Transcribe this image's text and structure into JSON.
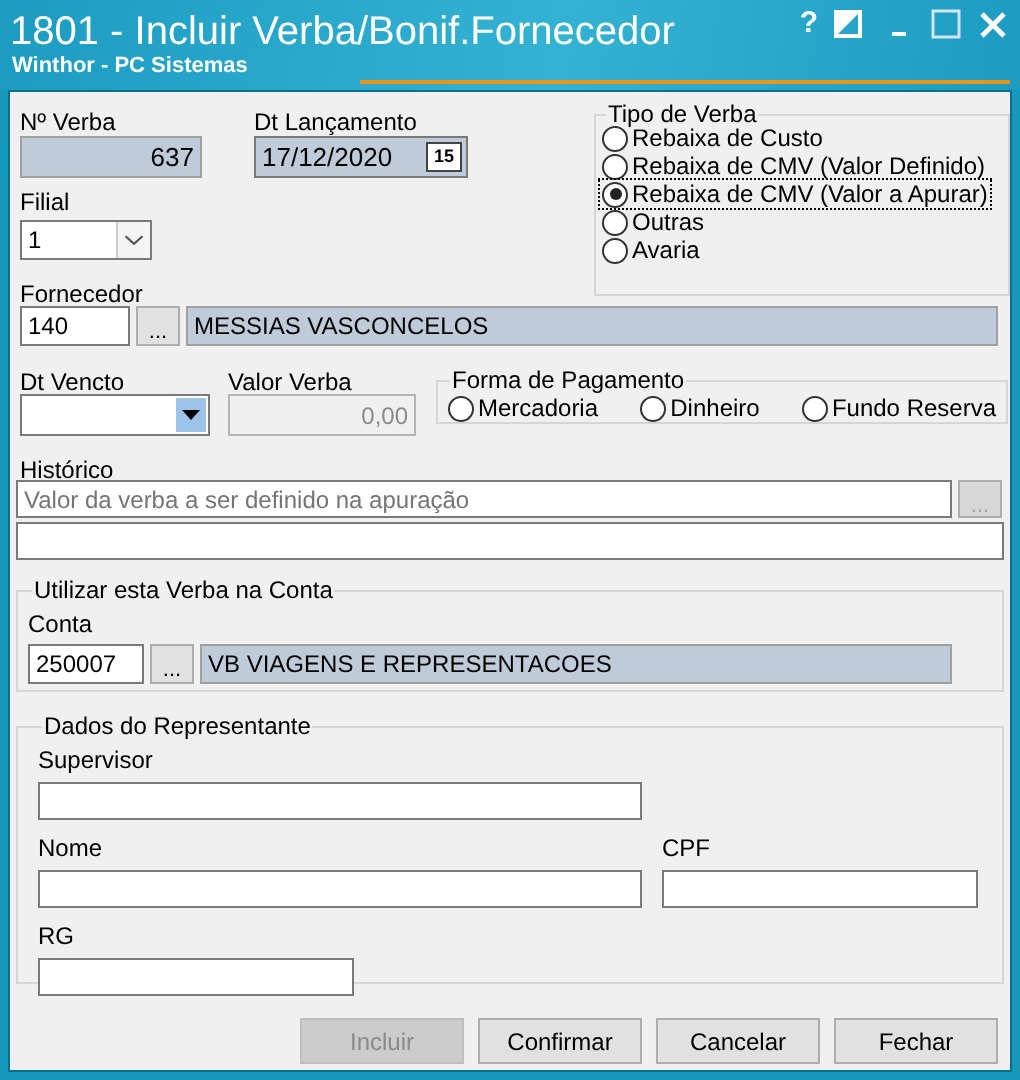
{
  "window": {
    "title": "1801 - Incluir Verba/Bonif.Fornecedor",
    "subtitle": "Winthor - PC Sistemas",
    "help_glyph": "?"
  },
  "verba_number": {
    "label": "Nº Verba",
    "value": "637",
    "readonly": true
  },
  "launch_date": {
    "label": "Dt Lançamento",
    "value": "17/12/2020",
    "readonly": true,
    "calendar_glyph": "15"
  },
  "branch": {
    "label": "Filial",
    "value": "1"
  },
  "tipo_de_verba": {
    "legend": "Tipo de Verba",
    "options": [
      {
        "label": "Rebaixa de Custo",
        "selected": false,
        "focused": false
      },
      {
        "label": "Rebaixa de CMV (Valor Definido)",
        "selected": false,
        "focused": false
      },
      {
        "label": "Rebaixa de CMV (Valor a Apurar)",
        "selected": true,
        "focused": true
      },
      {
        "label": "Outras",
        "selected": false,
        "focused": false
      },
      {
        "label": "Avaria",
        "selected": false,
        "focused": false
      }
    ]
  },
  "supplier": {
    "label": "Fornecedor",
    "code": "140",
    "lookup_glyph": "...",
    "name": "MESSIAS VASCONCELOS"
  },
  "due_date": {
    "label": "Dt Vencto"
  },
  "amount": {
    "label": "Valor Verba",
    "value": "0,00",
    "disabled": true
  },
  "payment": {
    "legend": "Forma de Pagamento",
    "options": [
      {
        "label": "Mercadoria",
        "selected": false
      },
      {
        "label": "Dinheiro",
        "selected": false
      },
      {
        "label": "Fundo Reserva",
        "selected": false
      }
    ]
  },
  "history": {
    "label": "Histórico",
    "placeholder": "Valor da verba a ser definido na apuração",
    "lookup_glyph": "...",
    "lookup_disabled": true
  },
  "account": {
    "legend": "Utilizar esta Verba na Conta",
    "label": "Conta",
    "code": "250007",
    "lookup_glyph": "...",
    "name": "VB VIAGENS E REPRESENTACOES"
  },
  "representative": {
    "legend": "Dados do Representante",
    "fields": [
      {
        "label": "Supervisor"
      },
      {
        "label": "Nome"
      },
      {
        "label": "CPF"
      },
      {
        "label": "RG"
      }
    ]
  },
  "buttons": [
    {
      "label": "Incluir",
      "disabled": true
    },
    {
      "label": "Confirmar",
      "disabled": false
    },
    {
      "label": "Cancelar",
      "disabled": false
    },
    {
      "label": "Fechar",
      "disabled": false
    }
  ]
}
